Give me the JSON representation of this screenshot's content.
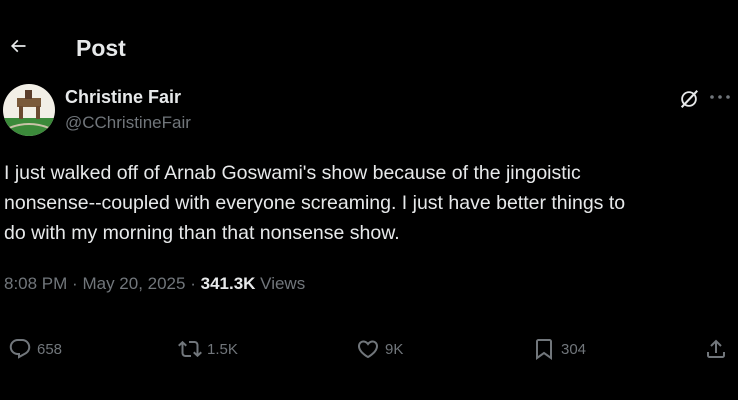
{
  "header": {
    "title": "Post",
    "back_icon": "arrow-left-icon"
  },
  "author": {
    "display_name": "Christine Fair",
    "handle": "@CChristineFair"
  },
  "tweet": {
    "text_lines": [
      "I just walked off of Arnab Goswami's show because of the jingoistic",
      "nonsense--coupled with everyone screaming. I just have better things to",
      "do with my morning than that nonsense show."
    ],
    "time": "8:08 PM",
    "separator": "·",
    "date": "May 20, 2025",
    "views_count": "341.3K",
    "views_label": "Views"
  },
  "actions": {
    "replies": "658",
    "reposts": "1.5K",
    "likes": "9K",
    "bookmarks": "304"
  },
  "colors": {
    "background": "#000000",
    "text": "#e7e9ea",
    "muted": "#71767b"
  },
  "icons": [
    "arrow-left-icon",
    "grok-icon",
    "more-icon",
    "reply-icon",
    "repost-icon",
    "like-icon",
    "bookmark-icon",
    "share-icon"
  ]
}
